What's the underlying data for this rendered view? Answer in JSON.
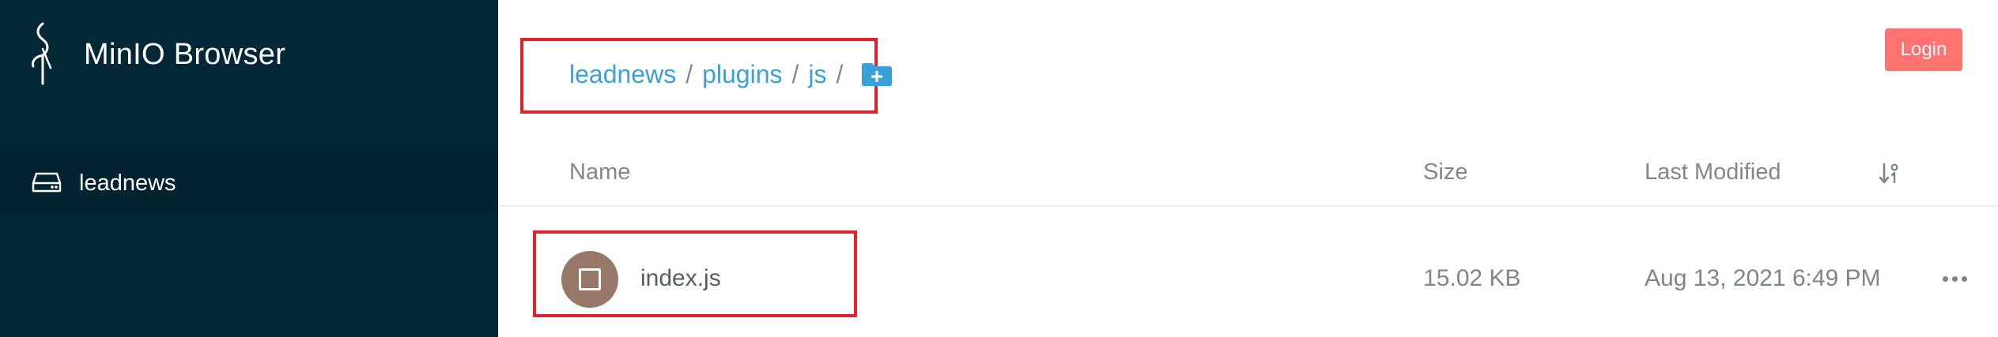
{
  "app": {
    "title": "MinIO Browser",
    "logo_icon": "minio-bird-icon"
  },
  "sidebar": {
    "buckets": [
      {
        "label": "leadnews",
        "icon": "hard-drive-icon"
      }
    ]
  },
  "breadcrumb": {
    "items": [
      "leadnews",
      "plugins",
      "js"
    ],
    "separator": "/",
    "add_folder_icon": "folder-plus-icon"
  },
  "header": {
    "login_label": "Login"
  },
  "table": {
    "columns": {
      "name": "Name",
      "size": "Size",
      "modified": "Last Modified"
    },
    "rows": [
      {
        "name": "index.js",
        "size": "15.02 KB",
        "modified": "Aug 13, 2021 6:49 PM",
        "icon": "file-icon"
      }
    ]
  },
  "colors": {
    "sidebar_bg": "#022836",
    "link": "#3aa1d8",
    "login_bg": "#ff726f",
    "highlight_box": "#e2232b",
    "file_avatar": "#977868"
  }
}
